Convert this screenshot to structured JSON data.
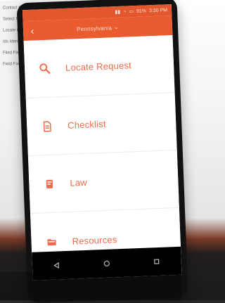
{
  "background_paper": {
    "lines": [
      "Contact the User Card Headlessness",
      "Select field",
      "Locate res",
      "Ids Identif",
      "Filed Fields",
      "Field Facilit"
    ]
  },
  "status_bar": {
    "battery_percent": "91%",
    "time": "3:30 PM"
  },
  "app_bar": {
    "title": "Pennsylvania",
    "back_icon": "arrow-left-icon",
    "dropdown_icon": "chevron-down-icon"
  },
  "menu": {
    "items": [
      {
        "label": "Locate Request",
        "icon": "search-icon"
      },
      {
        "label": "Checklist",
        "icon": "document-icon"
      },
      {
        "label": "Law",
        "icon": "book-icon"
      },
      {
        "label": "Resources",
        "icon": "folder-icon"
      }
    ]
  },
  "nav_bar": {
    "back_icon": "back-triangle-icon",
    "home_icon": "home-circle-icon",
    "recents_icon": "recents-square-icon"
  },
  "colors": {
    "primary": "#ea5b2f",
    "status_bar": "#e2572e",
    "menu_text": "#ef6b4b",
    "screen_bg": "#ffffff",
    "nav_bg": "#000000"
  }
}
